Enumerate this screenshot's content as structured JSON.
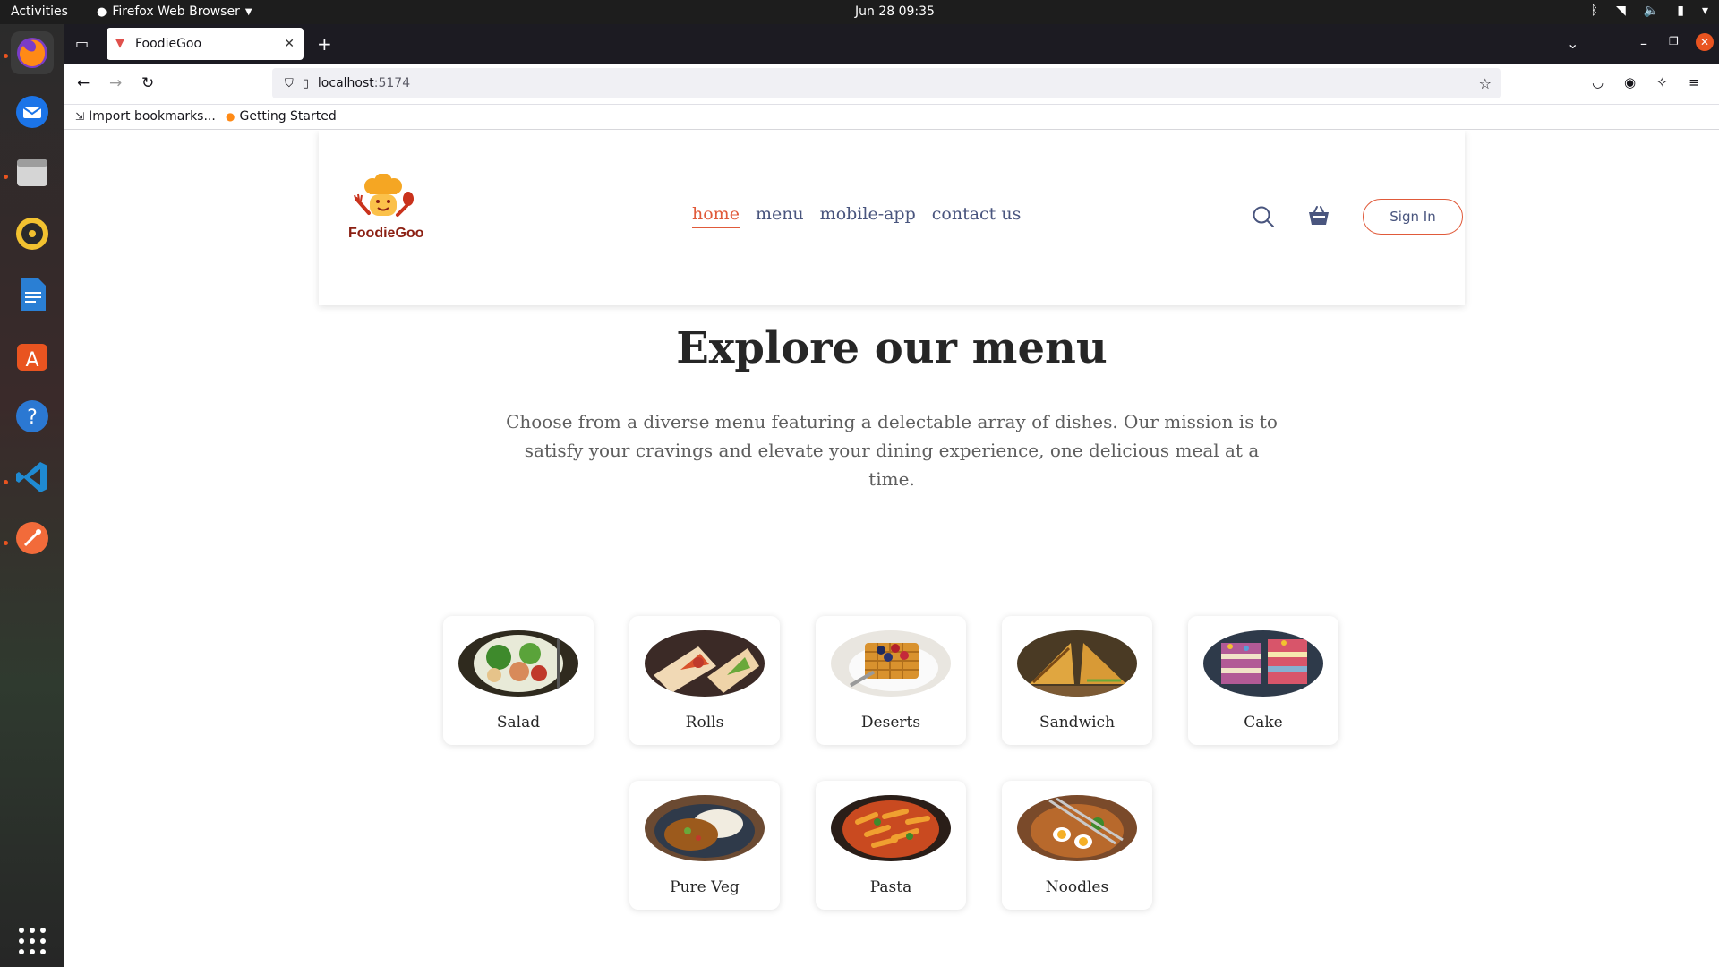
{
  "system_bar": {
    "activities": "Activities",
    "app_name": "Firefox Web Browser",
    "clock": "Jun 28  09:35"
  },
  "browser": {
    "tab_title": "FoodieGoo",
    "url_host": "localhost",
    "url_port": ":5174",
    "bookmarks": [
      "Import bookmarks...",
      "Getting Started"
    ]
  },
  "site": {
    "brand": "FoodieGoo",
    "nav": [
      "home",
      "menu",
      "mobile-app",
      "contact us"
    ],
    "active_nav": "home",
    "sign_in": "Sign In",
    "accent_color": "#e05a3a",
    "nav_color": "#49557e"
  },
  "menu_section": {
    "title": "Explore our menu",
    "description": "Choose from a diverse menu featuring a delectable array of dishes. Our mission is to satisfy your cravings and elevate your dining experience, one delicious meal at a time.",
    "items": [
      {
        "label": "Salad",
        "icon": "salad-image"
      },
      {
        "label": "Rolls",
        "icon": "rolls-image"
      },
      {
        "label": "Deserts",
        "icon": "deserts-image"
      },
      {
        "label": "Sandwich",
        "icon": "sandwich-image"
      },
      {
        "label": "Cake",
        "icon": "cake-image"
      },
      {
        "label": "Pure Veg",
        "icon": "pure-veg-image"
      },
      {
        "label": "Pasta",
        "icon": "pasta-image"
      },
      {
        "label": "Noodles",
        "icon": "noodles-image"
      }
    ]
  }
}
